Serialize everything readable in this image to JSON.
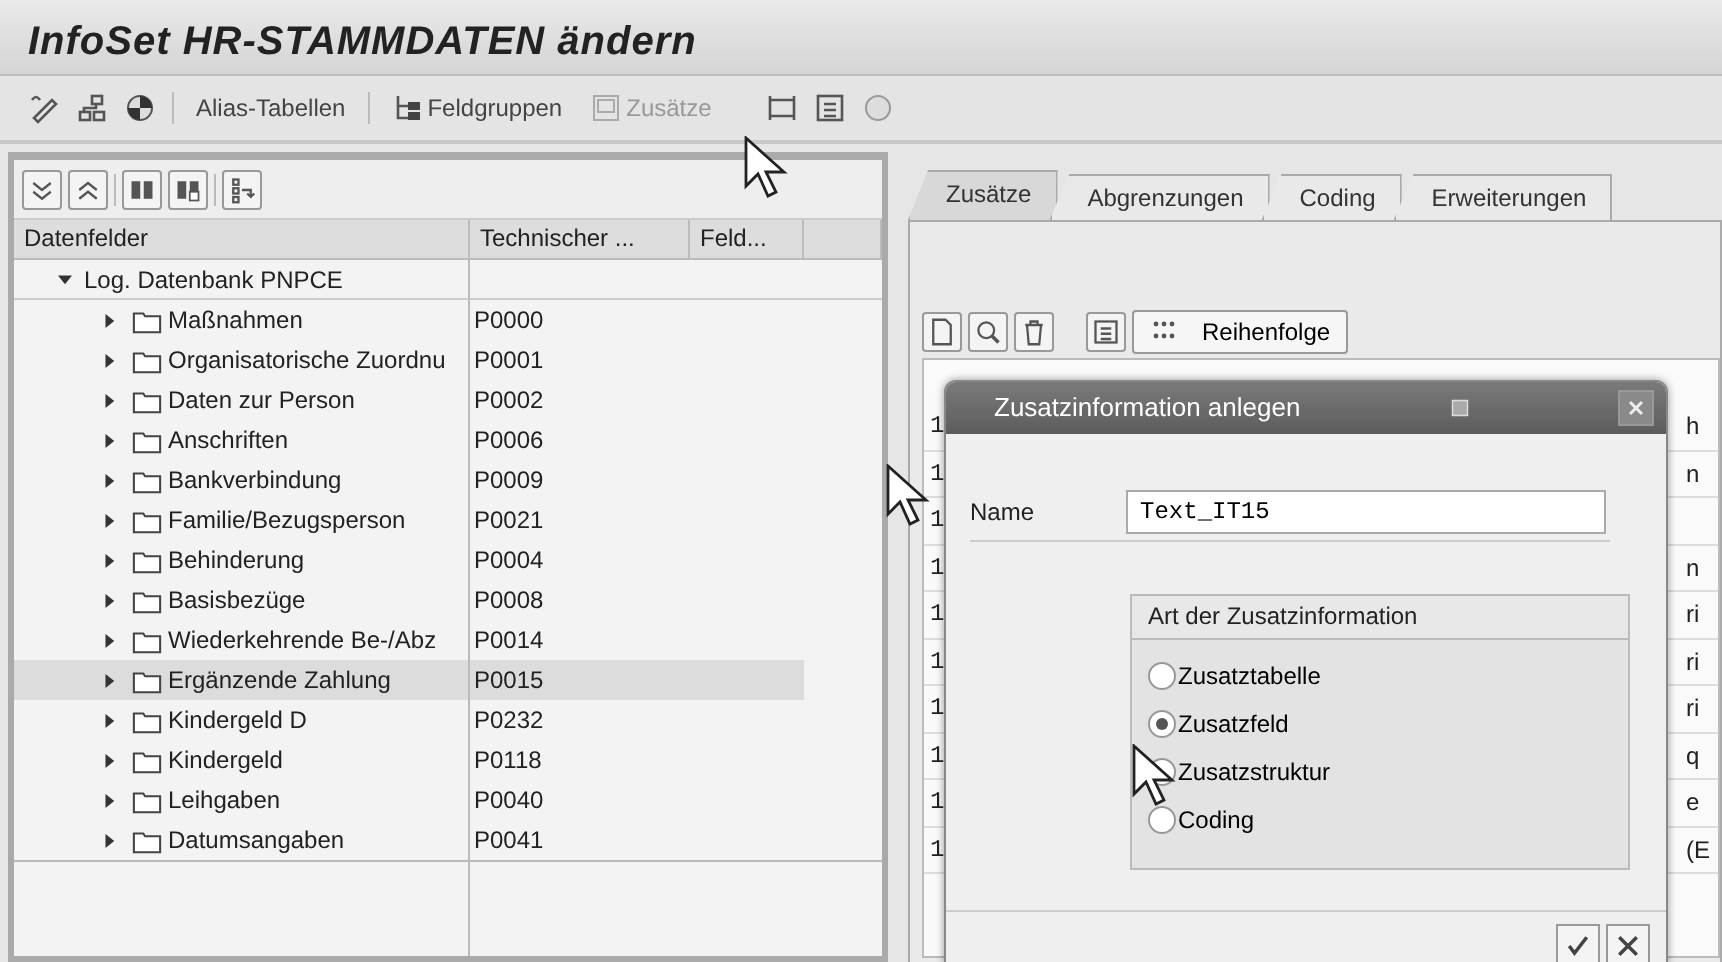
{
  "window": {
    "title": "InfoSet HR-STAMMDATEN ändern"
  },
  "toolbar": {
    "buttons": [
      {
        "label": "Alias-Tabellen",
        "disabled": false
      },
      {
        "label": "Feldgruppen",
        "disabled": false
      },
      {
        "label": "Zusätze",
        "disabled": true
      }
    ]
  },
  "field_tree": {
    "columns": [
      "Datenfelder",
      "Technischer ...",
      "Feld..."
    ],
    "root": {
      "label": "Log. Datenbank PNPCE",
      "expanded": true,
      "children": [
        {
          "label": "Maßnahmen",
          "code": "P0000",
          "expanded": false,
          "selected": false
        },
        {
          "label": "Organisatorische Zuordnu",
          "code": "P0001",
          "expanded": false,
          "selected": false
        },
        {
          "label": "Daten zur Person",
          "code": "P0002",
          "expanded": false,
          "selected": false
        },
        {
          "label": "Anschriften",
          "code": "P0006",
          "expanded": false,
          "selected": false
        },
        {
          "label": "Bankverbindung",
          "code": "P0009",
          "expanded": false,
          "selected": false
        },
        {
          "label": "Familie/Bezugsperson",
          "code": "P0021",
          "expanded": false,
          "selected": false
        },
        {
          "label": "Behinderung",
          "code": "P0004",
          "expanded": false,
          "selected": false
        },
        {
          "label": "Basisbezüge",
          "code": "P0008",
          "expanded": false,
          "selected": false
        },
        {
          "label": "Wiederkehrende Be-/Abz",
          "code": "P0014",
          "expanded": false,
          "selected": false
        },
        {
          "label": "Ergänzende Zahlung",
          "code": "P0015",
          "expanded": false,
          "selected": true
        },
        {
          "label": "Kindergeld D",
          "code": "P0232",
          "expanded": false,
          "selected": false
        },
        {
          "label": "Kindergeld",
          "code": "P0118",
          "expanded": false,
          "selected": false
        },
        {
          "label": "Leihgaben",
          "code": "P0040",
          "expanded": false,
          "selected": false
        },
        {
          "label": "Datumsangaben",
          "code": "P0041",
          "expanded": false,
          "selected": false
        }
      ]
    }
  },
  "tabs": [
    {
      "label": "Zusätze",
      "selected": true
    },
    {
      "label": "Abgrenzungen",
      "selected": false
    },
    {
      "label": "Coding",
      "selected": false
    },
    {
      "label": "Erweiterungen",
      "selected": false
    }
  ],
  "addons_toolbar": {
    "order_button": "Reihenfolge"
  },
  "addons_grid": {
    "rows": [
      {
        "column_1": "1",
        "column_3": "h"
      },
      {
        "column_1": "1",
        "column_3": "n"
      },
      {
        "column_1": "1"
      },
      {
        "column_1": "1",
        "column_3": "n"
      },
      {
        "column_1": "1",
        "column_3": "ri"
      },
      {
        "column_1": "1",
        "column_3": "ri"
      },
      {
        "column_1": "1",
        "column_3": "ri"
      },
      {
        "column_1": "1",
        "column_3": "q"
      },
      {
        "column_1": "1",
        "column_3": "e"
      },
      {
        "column_1": "1",
        "column_3": "(E"
      }
    ]
  },
  "dialog": {
    "title": "Zusatzinformation anlegen",
    "name_label": "Name",
    "name_value": "Text_IT15",
    "group_title": "Art der Zusatzinformation",
    "options": [
      {
        "label": "Zusatztabelle",
        "selected": false
      },
      {
        "label": "Zusatzfeld",
        "selected": true
      },
      {
        "label": "Zusatzstruktur",
        "selected": false
      },
      {
        "label": "Coding",
        "selected": false
      }
    ]
  }
}
